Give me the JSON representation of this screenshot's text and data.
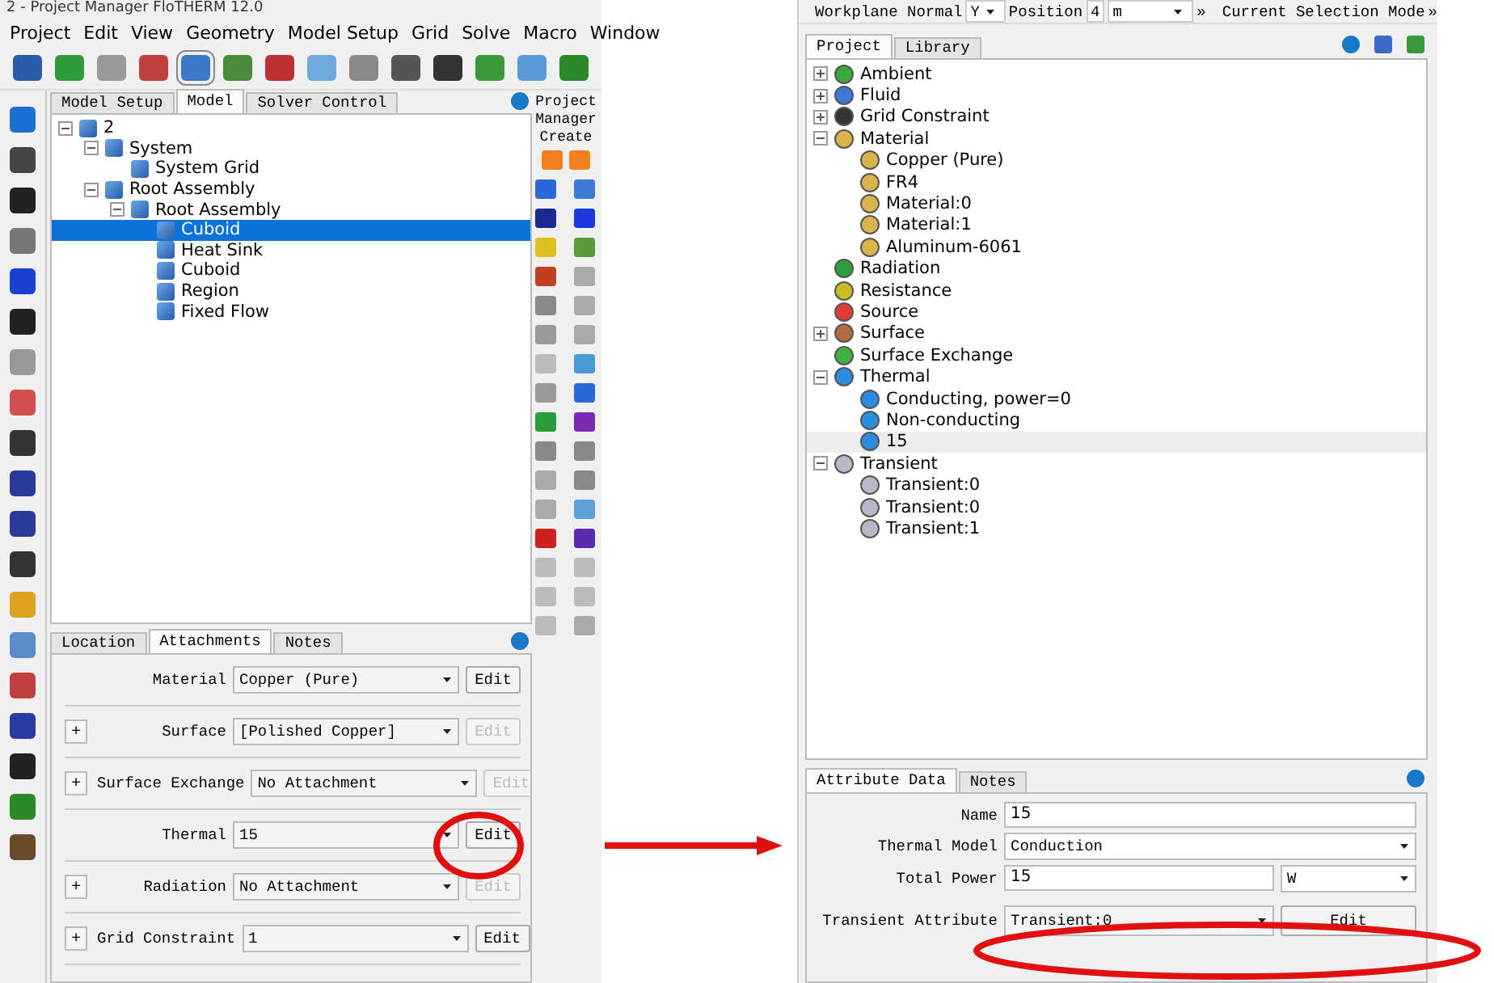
{
  "left_window": {
    "title": "2 - Project Manager FloTHERM 12.0",
    "menu": [
      "Project",
      "Edit",
      "View",
      "Geometry",
      "Model Setup",
      "Grid",
      "Solve",
      "Macro",
      "Window"
    ],
    "tabs": [
      {
        "label": "Model Setup",
        "selected": false
      },
      {
        "label": "Model",
        "selected": true
      },
      {
        "label": "Solver Control",
        "selected": false
      }
    ],
    "tree": [
      {
        "label": "2",
        "selected": false,
        "expanded": true,
        "children": [
          {
            "label": "System",
            "selected": false,
            "expanded": true,
            "children": [
              {
                "label": "System Grid",
                "selected": false
              }
            ]
          },
          {
            "label": "Root Assembly",
            "selected": false,
            "expanded": true,
            "children": [
              {
                "label": "Root Assembly",
                "selected": false,
                "expanded": true,
                "children": [
                  {
                    "label": "Cuboid",
                    "selected": true
                  },
                  {
                    "label": "Heat Sink",
                    "selected": false
                  },
                  {
                    "label": "Cuboid",
                    "selected": false
                  },
                  {
                    "label": "Region",
                    "selected": false
                  },
                  {
                    "label": "Fixed Flow",
                    "selected": false
                  }
                ]
              }
            ]
          }
        ]
      }
    ],
    "palette": {
      "title": "Project Manager Create"
    },
    "attachment_tabs": [
      {
        "label": "Location",
        "selected": false
      },
      {
        "label": "Attachments",
        "selected": true
      },
      {
        "label": "Notes",
        "selected": false
      }
    ],
    "attachments": [
      {
        "label": "Material",
        "value": "Copper (Pure)",
        "edit": "Edit",
        "edit_disabled": false
      },
      {
        "add": "+",
        "label": "Surface",
        "value": "[Polished Copper]",
        "edit": "Edit",
        "edit_disabled": true
      },
      {
        "add": "+",
        "label": "Surface Exchange",
        "value": "No Attachment",
        "edit": "Edit",
        "edit_disabled": true
      },
      {
        "label": "Thermal",
        "value": "15",
        "edit": "Edit",
        "edit_disabled": false
      },
      {
        "add": "+",
        "label": "Radiation",
        "value": "No Attachment",
        "edit": "Edit",
        "edit_disabled": true
      },
      {
        "add": "+",
        "label": "Grid Constraint",
        "value": "1",
        "edit": "Edit",
        "edit_disabled": false
      }
    ]
  },
  "right_window": {
    "toolbar": {
      "workplane_label": "Workplane Normal",
      "workplane_value": "Y",
      "position_label": "Position",
      "position_value": "4",
      "unit": "m",
      "more": "»",
      "selection_mode": "Current Selection Mode",
      "more_right": "»"
    },
    "tabs": [
      {
        "label": "Project",
        "selected": true
      },
      {
        "label": "Library",
        "selected": false
      }
    ],
    "tree": [
      {
        "label": "Ambient",
        "color": "#3aa83a",
        "selected": false,
        "expanded": false
      },
      {
        "label": "Fluid",
        "color": "#3b78d8",
        "selected": false,
        "expanded": false
      },
      {
        "label": "Grid Constraint",
        "color": "#333333",
        "selected": false,
        "expanded": false
      },
      {
        "label": "Material",
        "color": "#d9b44a",
        "selected": false,
        "expanded": true,
        "children": [
          {
            "label": "Copper (Pure)",
            "color": "#d9b44a",
            "selected": false
          },
          {
            "label": "FR4",
            "color": "#d9b44a",
            "selected": false
          },
          {
            "label": "Material:0",
            "color": "#d9b44a",
            "selected": false
          },
          {
            "label": "Material:1",
            "color": "#d9b44a",
            "selected": false
          },
          {
            "label": "Aluminum-6061",
            "color": "#d9b44a",
            "selected": false
          }
        ]
      },
      {
        "label": "Radiation",
        "color": "#2f9e3f",
        "selected": false
      },
      {
        "label": "Resistance",
        "color": "#c8c020",
        "selected": false
      },
      {
        "label": "Source",
        "color": "#e03a3a",
        "selected": false
      },
      {
        "label": "Surface",
        "color": "#b06a40",
        "selected": false,
        "expanded": false
      },
      {
        "label": "Surface Exchange",
        "color": "#40b040",
        "selected": false
      },
      {
        "label": "Thermal",
        "color": "#2a8de0",
        "selected": false,
        "expanded": true,
        "children": [
          {
            "label": "Conducting, power=0",
            "color": "#2a8de0",
            "selected": false
          },
          {
            "label": "Non-conducting",
            "color": "#2a8de0",
            "selected": false
          },
          {
            "label": "15",
            "color": "#2a8de0",
            "selected": true
          }
        ]
      },
      {
        "label": "Transient",
        "color": "#b8b8c8",
        "selected": false,
        "expanded": true,
        "children": [
          {
            "label": "Transient:0",
            "color": "#b8b8c8",
            "selected": false
          },
          {
            "label": "Transient:0",
            "color": "#b8b8c8",
            "selected": false
          },
          {
            "label": "Transient:1",
            "color": "#b8b8c8",
            "selected": false
          }
        ]
      }
    ],
    "attribute_tabs": [
      {
        "label": "Attribute Data",
        "selected": true
      },
      {
        "label": "Notes",
        "selected": false
      }
    ],
    "form": {
      "name_label": "Name",
      "name_value": "15",
      "model_label": "Thermal Model",
      "model_value": "Conduction",
      "power_label": "Total Power",
      "power_value": "15",
      "power_unit": "W",
      "transient_label": "Transient Attribute",
      "transient_value": "Transient:0",
      "edit": "Edit"
    }
  }
}
